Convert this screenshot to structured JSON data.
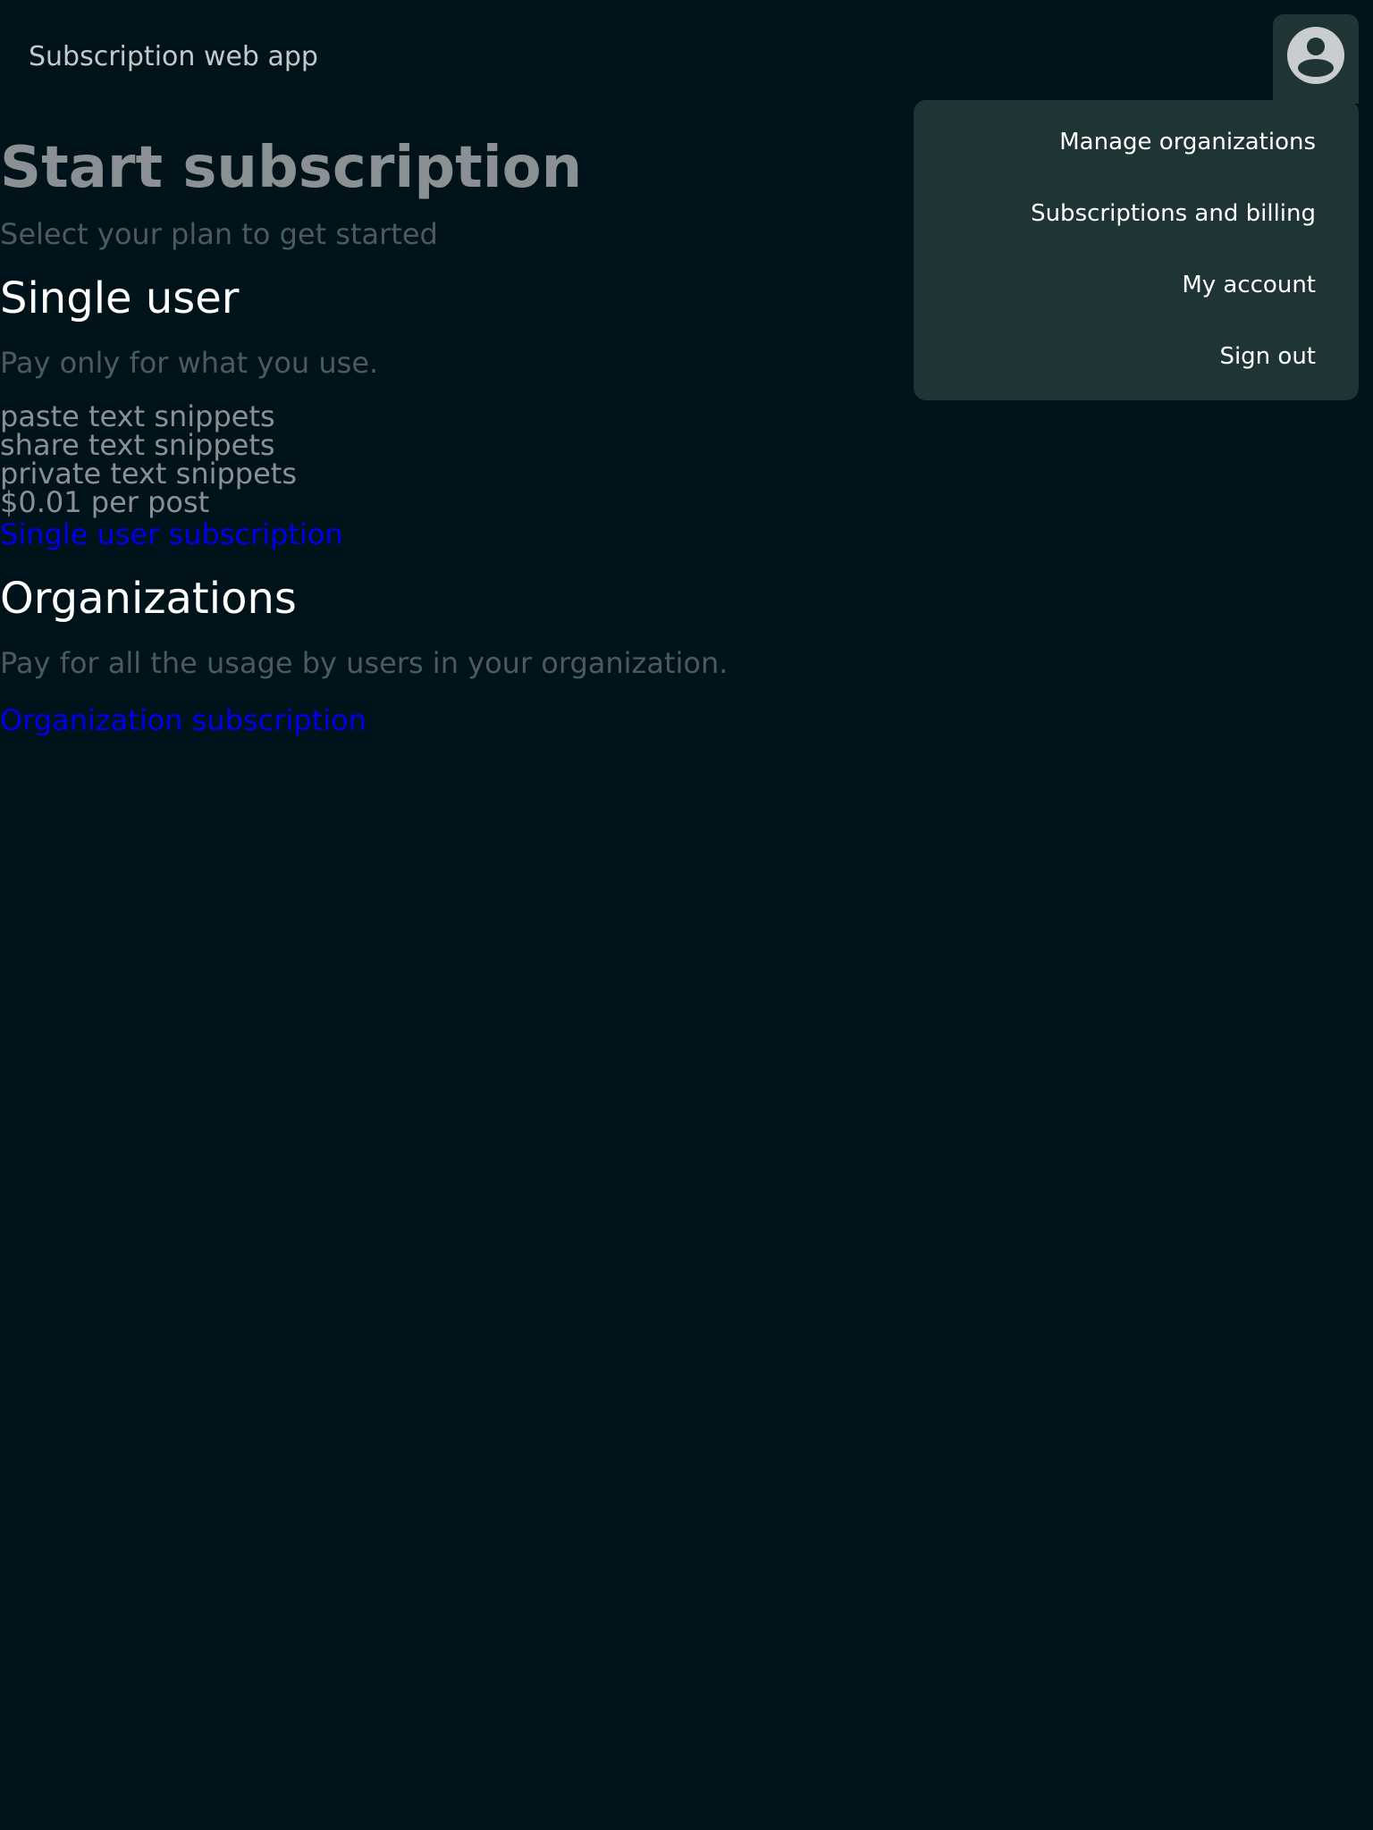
{
  "header": {
    "app_title": "Subscription web app",
    "avatar_icon": "account-circle-icon"
  },
  "user_menu": {
    "items": [
      {
        "label": "Manage organizations"
      },
      {
        "label": "Subscriptions and billing"
      },
      {
        "label": "My account"
      },
      {
        "label": "Sign out"
      }
    ]
  },
  "main": {
    "title": "Start subscription",
    "subtitle": "Select your plan to get started",
    "plans": [
      {
        "name": "Single user",
        "description": "Pay only for what you use.",
        "features": [
          "paste text snippets",
          "share text snippets",
          "private text snippets",
          "$0.01 per post"
        ],
        "link_label": "Single user subscription"
      },
      {
        "name": "Organizations",
        "description": "Pay for all the usage by users in your organization.",
        "link_label": "Organization subscription"
      }
    ]
  },
  "colors": {
    "background": "#00131a",
    "menu_background": "#1e3435",
    "link": "#0000ee",
    "heading": "#ffffff",
    "muted": "#4b5a5e"
  }
}
